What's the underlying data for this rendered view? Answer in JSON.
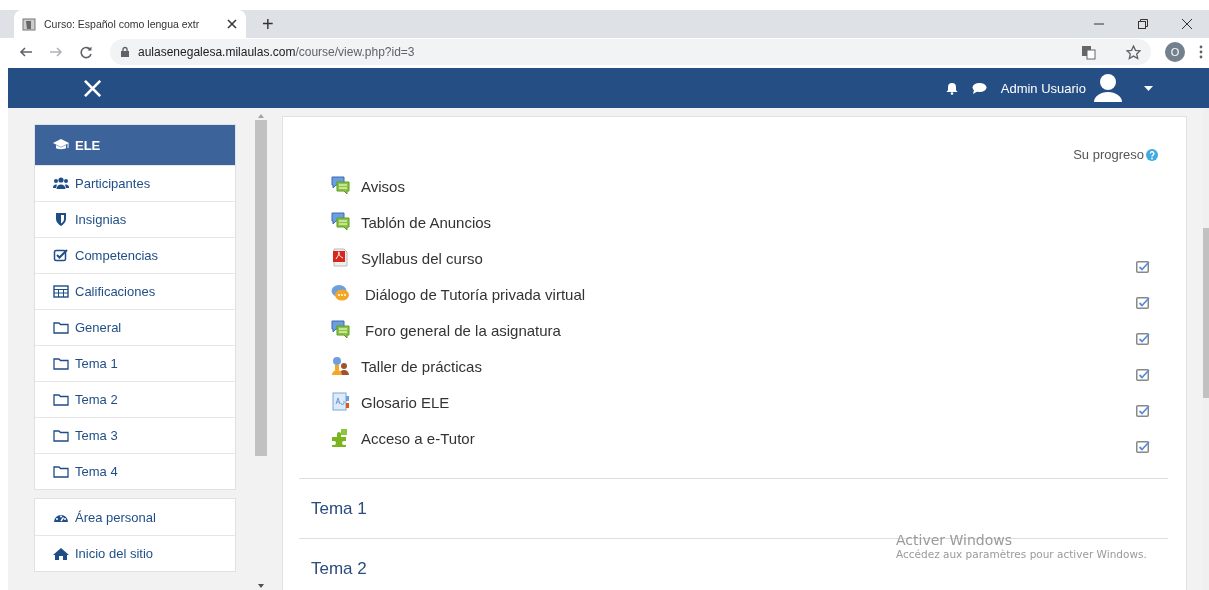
{
  "browser": {
    "tab": {
      "title": "Curso: Español como lengua extr",
      "selected": true
    },
    "new_tab": "+",
    "address": {
      "host": "aulasenegalesa.milaulas.com",
      "path": "/course/view.php?id=3"
    },
    "profile": "O"
  },
  "navbar": {
    "close": "×",
    "user": "Admin Usuario"
  },
  "sidebar": {
    "groups": [
      {
        "items": [
          {
            "label": "ELE",
            "kind": "course",
            "selected": true
          },
          {
            "label": "Participantes",
            "kind": "users",
            "selected": false
          },
          {
            "label": "Insignias",
            "kind": "badges",
            "selected": false
          },
          {
            "label": "Competencias",
            "kind": "competencies",
            "selected": false
          },
          {
            "label": "Calificaciones",
            "kind": "grades",
            "selected": false
          },
          {
            "label": "General",
            "kind": "section",
            "selected": false
          },
          {
            "label": "Tema 1",
            "kind": "section",
            "selected": false
          },
          {
            "label": "Tema 2",
            "kind": "section",
            "selected": false
          },
          {
            "label": "Tema 3",
            "kind": "section",
            "selected": false
          },
          {
            "label": "Tema 4",
            "kind": "section",
            "selected": false
          }
        ]
      },
      {
        "items": [
          {
            "label": "Área personal",
            "kind": "dashboard",
            "selected": false
          },
          {
            "label": "Inicio del sitio",
            "kind": "home",
            "selected": false
          }
        ]
      }
    ]
  },
  "course": {
    "progress_label": "Su progreso",
    "activities": [
      {
        "name": "Avisos",
        "kind": "forum"
      },
      {
        "name": "Tablón de Anuncios",
        "kind": "forum"
      },
      {
        "name": "Syllabus del curso",
        "kind": "pdf",
        "completion": {
          "checked": true
        }
      },
      {
        "name": "Diálogo de Tutoría privada virtual",
        "kind": "chat",
        "completion": {
          "checked": true
        }
      },
      {
        "name": "Foro general de la asignatura",
        "kind": "forum",
        "completion": {
          "checked": true
        }
      },
      {
        "name": "Taller de prácticas",
        "kind": "workshop",
        "completion": {
          "checked": true
        }
      },
      {
        "name": "Glosario ELE",
        "kind": "glossary",
        "completion": {
          "checked": true
        }
      },
      {
        "name": "Acceso a e-Tutor",
        "kind": "puzzle",
        "completion": {
          "checked": true
        }
      }
    ],
    "sections": [
      "Tema 1",
      "Tema 2"
    ]
  },
  "os_notice": {
    "title": "Activer Windows",
    "text": "Accédez aux paramètres pour activer Windows."
  }
}
